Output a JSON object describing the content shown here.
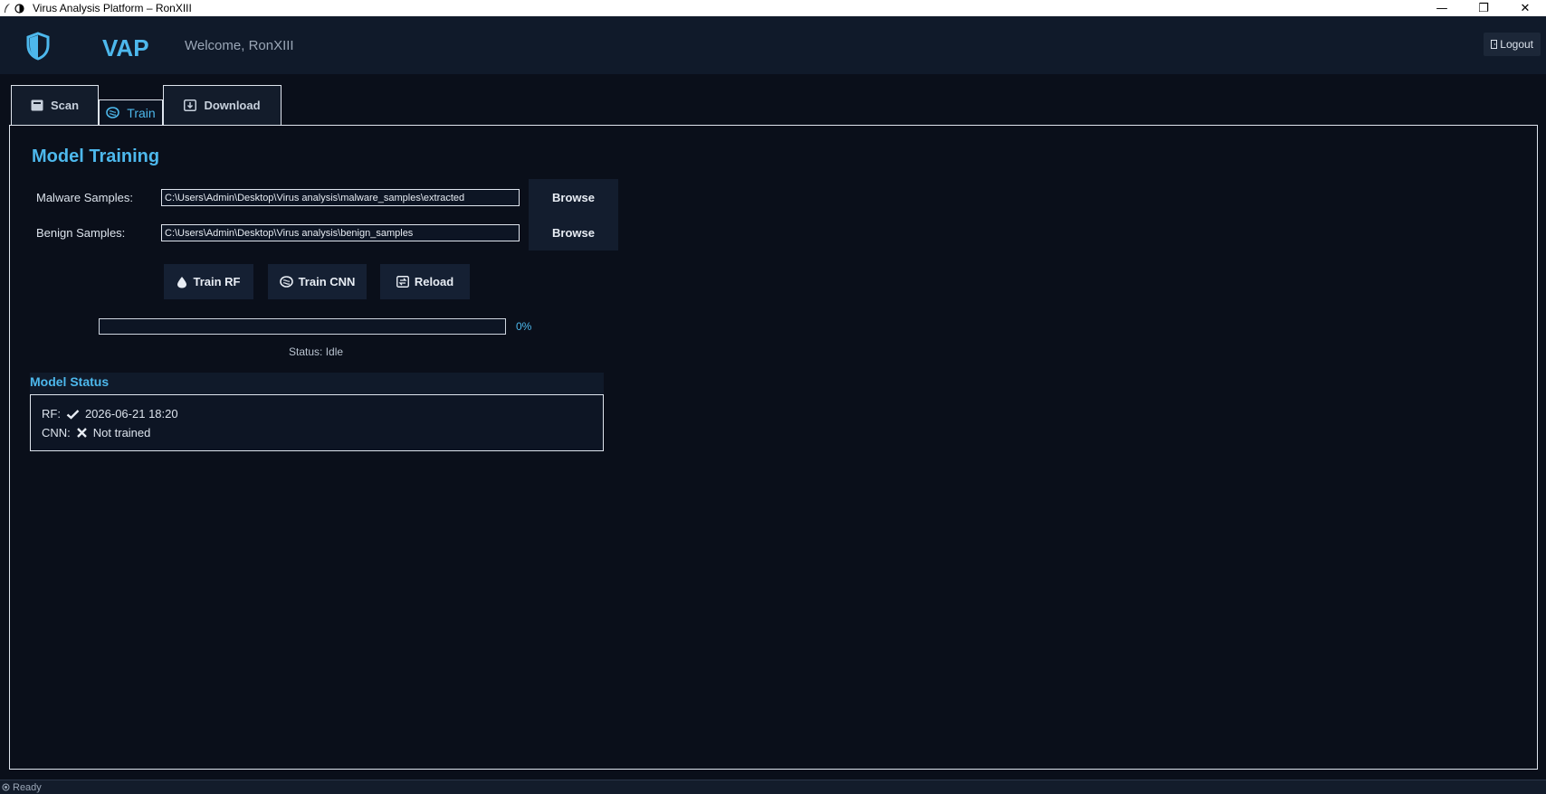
{
  "window": {
    "title": "Virus Analysis Platform – RonXIII",
    "controls": {
      "minimize": "—",
      "restore": "❐",
      "close": "✕"
    }
  },
  "header": {
    "brand": "VAP",
    "welcome": "Welcome, RonXIII",
    "logout_label": "Logout",
    "accent_color": "#4db8ec"
  },
  "tabs": [
    {
      "label": "Scan",
      "icon": "archive-box-icon",
      "active": false
    },
    {
      "label": "Train",
      "icon": "brain-icon",
      "active": true
    },
    {
      "label": "Download",
      "icon": "download-icon",
      "active": false
    }
  ],
  "training": {
    "title": "Model Training",
    "malware_label": "Malware Samples:",
    "malware_path": "C:\\Users\\Admin\\Desktop\\Virus analysis\\malware_samples\\extracted",
    "benign_label": "Benign Samples:",
    "benign_path": "C:\\Users\\Admin\\Desktop\\Virus analysis\\benign_samples",
    "browse_label": "Browse",
    "actions": {
      "train_rf": "Train RF",
      "train_cnn": "Train CNN",
      "reload": "Reload"
    },
    "progress_fraction": 0,
    "progress_text": "0%",
    "status_text": "Status: Idle"
  },
  "model_status": {
    "title": "Model Status",
    "rf_label": "RF:",
    "rf_value": "2026-06-21 18:20",
    "cnn_label": "CNN:",
    "cnn_value": "Not trained"
  },
  "statusbar": {
    "text": "Ready"
  }
}
